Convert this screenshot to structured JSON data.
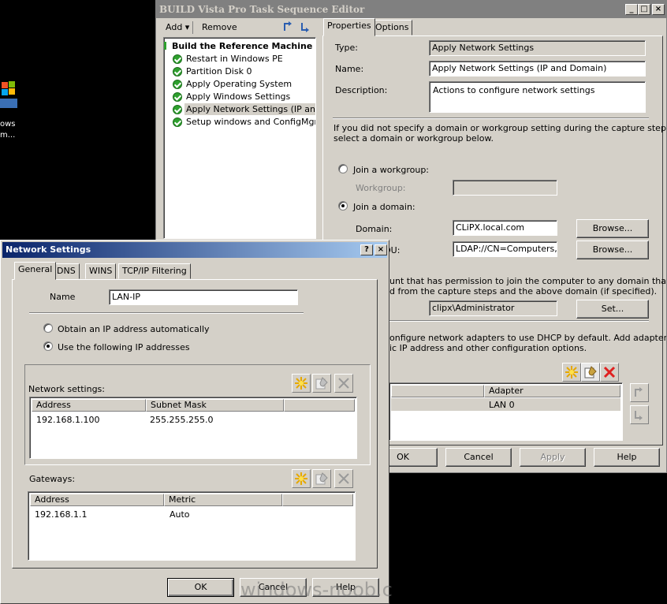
{
  "desktop": {
    "icon_label_1": "ows",
    "icon_label_2": "m..."
  },
  "editor": {
    "title": "BUILD Vista Pro Task Sequence Editor",
    "window_buttons": {
      "minimize": "_",
      "maximize": "□",
      "close": "×"
    },
    "toolbar": {
      "add": "Add",
      "remove": "Remove"
    },
    "tree": {
      "root": "Build the Reference Machine",
      "items": [
        "Restart in Windows PE",
        "Partition Disk 0",
        "Apply Operating System",
        "Apply Windows Settings",
        "Apply Network Settings (IP and Domain)",
        "Setup windows and ConfigMgr"
      ],
      "selected_index": 4
    },
    "tabs": [
      "Properties",
      "Options"
    ],
    "properties": {
      "type_label": "Type:",
      "type_value": "Apply Network Settings",
      "name_label": "Name:",
      "name_value": "Apply Network Settings (IP and Domain)",
      "description_label": "Description:",
      "description_value": "Actions to configure network settings",
      "domain_intro_1": "If you did not specify a domain or workgroup setting during the capture steps,",
      "domain_intro_2": "select a domain or workgroup below.",
      "join_workgroup": "Join a workgroup:",
      "workgroup_label": "Workgroup:",
      "join_domain": "Join a domain:",
      "domain_label": "Domain:",
      "domain_value": "CLiPX.local.com",
      "browse": "Browse...",
      "ou_label_partial": "OU:",
      "ou_value": "LDAP://CN=Computers,DC",
      "account_text_1": "unt that has permission to join the computer to any domain that",
      "account_text_2": "d from the capture steps and the above domain (if specified).",
      "account_value": "clipx\\Administrator",
      "set": "Set...",
      "adapter_text_1": "onfigure network adapters to use DHCP by default. Add adapters",
      "adapter_text_2": "ic IP address and other configuration options.",
      "adapter_header": "Adapter",
      "adapter_value": "LAN 0"
    },
    "buttons": {
      "ok": "OK",
      "cancel": "Cancel",
      "apply": "Apply",
      "help": "Help"
    }
  },
  "dialog": {
    "title": "Network Settings",
    "title_buttons": {
      "help": "?",
      "close": "×"
    },
    "tabs": [
      "General",
      "DNS",
      "WINS",
      "TCP/IP Filtering"
    ],
    "name_label": "Name",
    "name_value": "LAN-IP",
    "obtain_auto": "Obtain an IP address automatically",
    "use_following": "Use the following IP addresses",
    "network_settings_label": "Network settings:",
    "ip_columns": [
      "Address",
      "Subnet Mask"
    ],
    "ip_rows": [
      {
        "address": "192.168.1.100",
        "mask": "255.255.255.0"
      }
    ],
    "gateways_label": "Gateways:",
    "gw_columns": [
      "Address",
      "Metric"
    ],
    "gw_rows": [
      {
        "address": "192.168.1.1",
        "metric": "Auto"
      }
    ],
    "buttons": {
      "ok": "OK",
      "cancel": "Cancel",
      "help": "Help"
    }
  },
  "watermark": "windows-noob.c",
  "colors": {
    "title_active": "#0a246a",
    "title_inactive": "#808080",
    "face": "#d4d0c8"
  }
}
